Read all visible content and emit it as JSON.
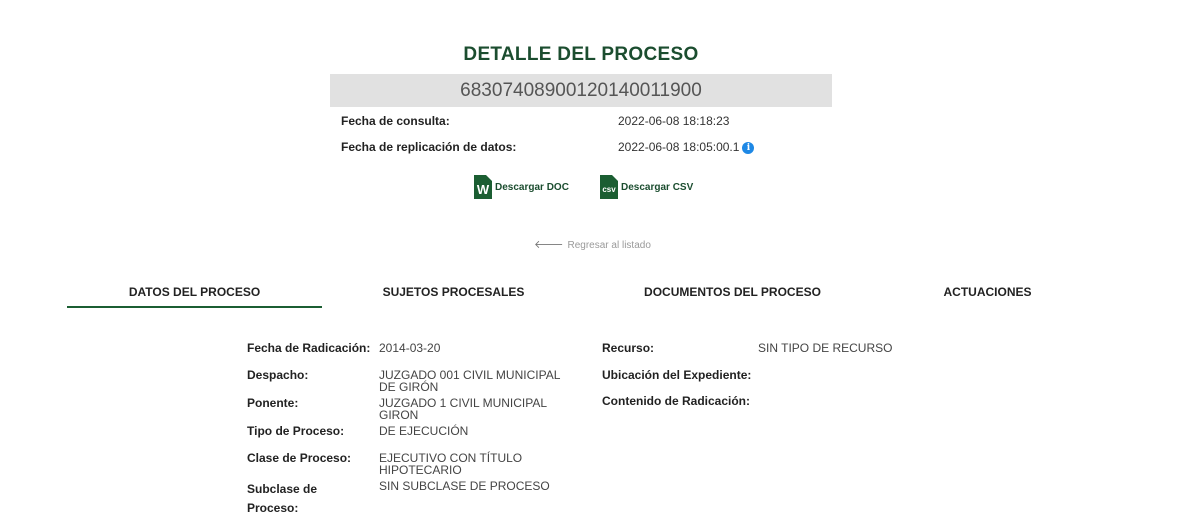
{
  "header": {
    "title": "DETALLE DEL PROCESO",
    "process_number": "68307408900120140011900"
  },
  "meta": {
    "consulta_label": "Fecha de consulta:",
    "consulta_value": "2022-06-08 18:18:23",
    "replicacion_label": "Fecha de replicación de datos:",
    "replicacion_value": "2022-06-08 18:05:00.1",
    "info_icon_glyph": "i"
  },
  "downloads": {
    "doc_icon_text": "W",
    "doc_label": "Descargar DOC",
    "csv_icon_text": "csv",
    "csv_label": "Descargar CSV"
  },
  "back": {
    "arrow": "🡐",
    "label": "Regresar al listado"
  },
  "tabs": [
    {
      "label": "DATOS DEL PROCESO",
      "active": true
    },
    {
      "label": "SUJETOS PROCESALES",
      "active": false
    },
    {
      "label": "DOCUMENTOS DEL PROCESO",
      "active": false
    },
    {
      "label": "ACTUACIONES",
      "active": false
    }
  ],
  "details_left": [
    {
      "label": "Fecha de Radicación:",
      "value": "2014-03-20"
    },
    {
      "label": "Despacho:",
      "value": "JUZGADO 001 CIVIL MUNICIPAL DE GIRÓN"
    },
    {
      "label": "Ponente:",
      "value": "JUZGADO 1 CIVIL MUNICIPAL GIRON"
    },
    {
      "label": "Tipo de Proceso:",
      "value": "DE EJECUCIÓN"
    },
    {
      "label": "Clase de Proceso:",
      "value": "EJECUTIVO CON TÍTULO HIPOTECARIO"
    },
    {
      "label": "Subclase de Proceso:",
      "value": "SIN SUBCLASE DE PROCESO"
    }
  ],
  "details_right": [
    {
      "label": "Recurso:",
      "value": "SIN TIPO DE RECURSO"
    },
    {
      "label": "Ubicación del Expediente:",
      "value": ""
    },
    {
      "label": "Contenido de Radicación:",
      "value": ""
    }
  ],
  "colors": {
    "brand_green": "#1b4d2f",
    "info_blue": "#1e88e5",
    "number_box_bg": "#e1e1e1"
  }
}
